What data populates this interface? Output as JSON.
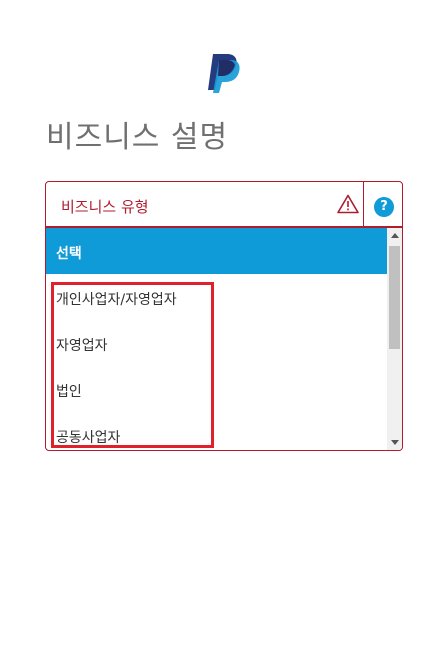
{
  "page": {
    "title": "비즈니스 설명"
  },
  "select": {
    "label": "비즈니스 유형",
    "help_glyph": "?",
    "options": [
      {
        "label": "선택",
        "selected": true
      },
      {
        "label": "개인사업자/자영업자",
        "selected": false
      },
      {
        "label": "자영업자",
        "selected": false
      },
      {
        "label": "법인",
        "selected": false
      },
      {
        "label": "공동사업자",
        "selected": false
      }
    ]
  },
  "icons": {
    "logo": "paypal-logo",
    "warning": "warning-icon",
    "help": "help-icon"
  },
  "colors": {
    "error": "#b01c2e",
    "accent": "#0e9bd8",
    "highlight": "#e0202b",
    "title_text": "#707070",
    "logo_dark": "#253b80",
    "logo_light": "#179bd7"
  }
}
